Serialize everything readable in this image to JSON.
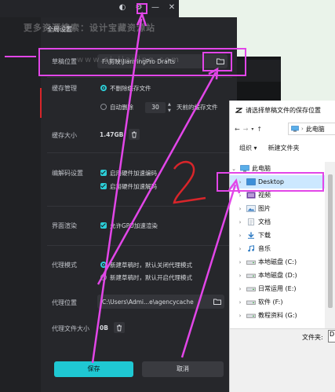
{
  "top_icons": [
    "◐",
    "⚙",
    "—",
    "✕"
  ],
  "panel": {
    "title": "全局设置",
    "watermark_main": "更多资源搜索：设计宝藏资源站",
    "watermark_url": "www.sj-jiaying.com",
    "draft_location": {
      "label": "草稿位置",
      "value": "F:\\剪映\\JianyingPro Drafts"
    },
    "cache_management": {
      "label": "缓存管理",
      "option_never": "不删除缓存文件",
      "option_auto": "自动删除",
      "days_value": "30",
      "days_suffix": "天前的缓存文件"
    },
    "cache_size": {
      "label": "缓存大小",
      "value": "1.47GB"
    },
    "codec": {
      "label": "编解码设置",
      "hw_encode": "启用硬件加速编码",
      "hw_decode": "启用硬件加速解码"
    },
    "render": {
      "label": "界面渲染",
      "gpu": "允许GPU加速渲染"
    },
    "proxy_mode": {
      "label": "代理模式",
      "option_off": "新建草稿时，默认关闭代理模式",
      "option_on": "新建草稿时，默认开启代理模式"
    },
    "proxy_location": {
      "label": "代理位置",
      "value": "C:\\Users\\Admi...e\\agencycache"
    },
    "proxy_size": {
      "label": "代理文件大小",
      "value": "0B"
    },
    "save": "保存",
    "cancel": "取消"
  },
  "dialog": {
    "title": "请选择草稿文件的保存位置",
    "address": "此电脑",
    "organize": "组织 ▾",
    "new_folder": "新建文件夹",
    "tree": [
      {
        "label": "此电脑",
        "icon": "pc-icon",
        "expanded": true,
        "indent": 0
      },
      {
        "label": "Desktop",
        "icon": "desktop-folder-icon",
        "selected": true,
        "indent": 1
      },
      {
        "label": "视频",
        "icon": "video-folder-icon",
        "indent": 1
      },
      {
        "label": "图片",
        "icon": "picture-folder-icon",
        "indent": 1
      },
      {
        "label": "文档",
        "icon": "document-folder-icon",
        "indent": 1
      },
      {
        "label": "下载",
        "icon": "download-folder-icon",
        "indent": 1
      },
      {
        "label": "音乐",
        "icon": "music-folder-icon",
        "indent": 1
      },
      {
        "label": "本地磁盘 (C:)",
        "icon": "drive-icon",
        "indent": 1
      },
      {
        "label": "本地磁盘 (D:)",
        "icon": "drive-icon",
        "indent": 1
      },
      {
        "label": "日常运用 (E:)",
        "icon": "drive-icon",
        "indent": 1
      },
      {
        "label": "软件 (F:)",
        "icon": "drive-icon",
        "indent": 1
      },
      {
        "label": "教程资料 (G:)",
        "icon": "drive-icon",
        "indent": 1
      }
    ],
    "filename_label": "文件夹:",
    "filename_value": "D"
  },
  "annotation": {
    "step_number": "2",
    "color": "#e246e8",
    "accent": "#1fc8d3"
  }
}
